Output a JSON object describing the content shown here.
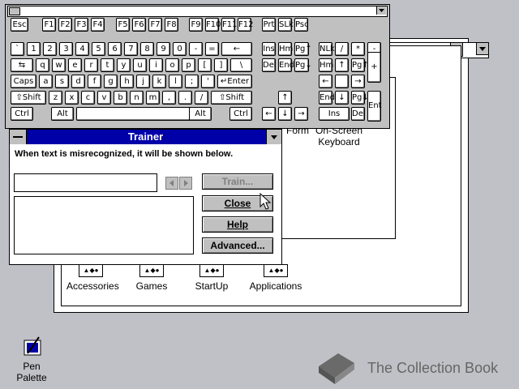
{
  "program_manager": {
    "groups": [
      {
        "label": "Accessories"
      },
      {
        "label": "Games"
      },
      {
        "label": "StartUp"
      },
      {
        "label": "Applications"
      }
    ],
    "inner_items": [
      {
        "label": "Form"
      },
      {
        "label": "On-Screen Keyboard"
      }
    ]
  },
  "keyboard": {
    "rows": [
      [
        "Esc",
        "F1",
        "F2",
        "F3",
        "F4",
        "F5",
        "F6",
        "F7",
        "F8",
        "F9",
        "F10",
        "F11",
        "F12",
        "Prt",
        "SLk",
        "Psc"
      ],
      [
        "`",
        "1",
        "2",
        "3",
        "4",
        "5",
        "6",
        "7",
        "8",
        "9",
        "0",
        "-",
        "=",
        "←",
        "Ins",
        "Hm",
        "Pg↑",
        "NLk",
        "/",
        "*",
        "-"
      ],
      [
        "⇆",
        "q",
        "w",
        "e",
        "r",
        "t",
        "y",
        "u",
        "i",
        "o",
        "p",
        "[",
        "]",
        "\\",
        "Del",
        "End",
        "Pg↓",
        "Hm",
        "↑",
        "Pg↑",
        "+"
      ],
      [
        "Caps",
        "a",
        "s",
        "d",
        "f",
        "g",
        "h",
        "j",
        "k",
        "l",
        ";",
        "'",
        "↵Enter",
        "←",
        "",
        "→"
      ],
      [
        "⇧Shift",
        "z",
        "x",
        "c",
        "v",
        "b",
        "n",
        "m",
        ",",
        ".",
        "/",
        "⇧Shift",
        "↑",
        "End",
        "↓",
        "Pg↓",
        "Ent"
      ],
      [
        "Ctrl",
        "Alt",
        "",
        "Alt",
        "Ctrl",
        "←",
        "↓",
        "→",
        "Ins",
        "Del"
      ]
    ]
  },
  "trainer": {
    "title": "Trainer",
    "message": "When text is misrecognized, it will be shown below.",
    "buttons": {
      "train": "Train...",
      "close": "Close",
      "help": "Help",
      "advanced": "Advanced..."
    }
  },
  "desktop": {
    "pen_palette": "Pen Palette",
    "watermark": "The Collection Book"
  }
}
